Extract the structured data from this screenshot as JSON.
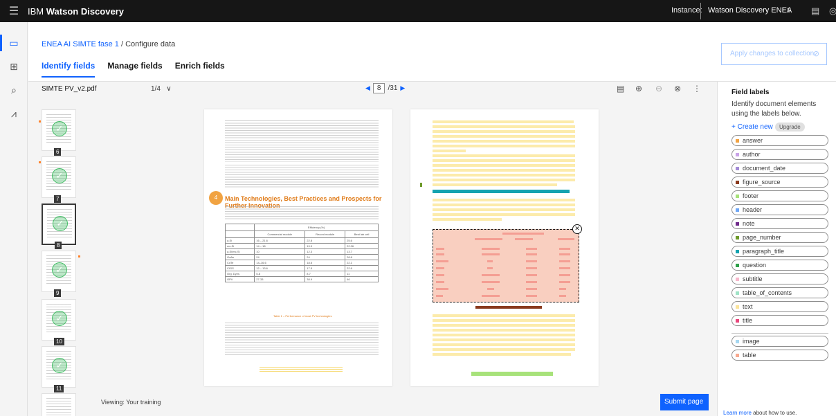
{
  "app": {
    "brand_prefix": "IBM",
    "brand_name": "Watson Discovery",
    "instance_label": "Instance:",
    "instance_value": "Watson Discovery ENEA"
  },
  "breadcrumb": {
    "project": "ENEA AI SIMTE fase 1",
    "separator": "/",
    "current": "Configure data"
  },
  "tabs": [
    "Identify fields",
    "Manage fields",
    "Enrich fields"
  ],
  "apply_button": "Apply changes to collection",
  "toolbar": {
    "filename": "SIMTE PV_v2.pdf",
    "page_range": "1/4",
    "current_page": "8",
    "total_pages": "/31"
  },
  "thumbnails": [
    "6",
    "7",
    "8",
    "9",
    "10",
    "11"
  ],
  "document": {
    "section_heading": "Main Technologies, Best Practices and Prospects for Further Innovation",
    "badge": "4",
    "table_title": "Efficiency (%)",
    "table_headers": [
      "Commercial module",
      "Record module",
      "Best lab cell"
    ],
    "table_rows": [
      [
        "a-Si",
        "16 – 21.6",
        "22.8",
        "25.6"
      ],
      [
        "mc-Si",
        "14 – 18",
        "19.9",
        "22.26"
      ],
      [
        "a-Si/mc-Si",
        "10",
        "12.3",
        "13.7"
      ],
      [
        "GaAs",
        "24",
        "24",
        "28.8"
      ],
      [
        "CdTe",
        "14–16.6",
        "18.6",
        "22.1"
      ],
      [
        "CIGS",
        "12 – 13.6",
        "17.5",
        "22.6"
      ],
      [
        "Org. Dyes",
        "5-8",
        "8.7",
        "11"
      ],
      [
        "OPV",
        "27-33",
        "38.9",
        "46"
      ]
    ],
    "table_caption": "Table 1 – Performance of most PV technologies"
  },
  "viewer": {
    "viewing_text": "Viewing: Your training",
    "submit_label": "Submit page"
  },
  "field_panel": {
    "title": "Field labels",
    "description": "Identify document elements using the labels below.",
    "create_new": "+ Create new",
    "upgrade": "Upgrade",
    "labels": [
      {
        "name": "answer",
        "color": "#f1a342"
      },
      {
        "name": "author",
        "color": "#c9a3e8"
      },
      {
        "name": "document_date",
        "color": "#a38bd6"
      },
      {
        "name": "figure_source",
        "color": "#8a3a1e"
      },
      {
        "name": "footer",
        "color": "#a7e27a"
      },
      {
        "name": "header",
        "color": "#6ea6f5"
      },
      {
        "name": "note",
        "color": "#6f2a8a"
      },
      {
        "name": "page_number",
        "color": "#6d9a2a"
      },
      {
        "name": "paragraph_title",
        "color": "#15a3b0"
      },
      {
        "name": "question",
        "color": "#2ea04a"
      },
      {
        "name": "subtitle",
        "color": "#f7b8cc"
      },
      {
        "name": "table_of_contents",
        "color": "#9fe3c6"
      },
      {
        "name": "text",
        "color": "#fbe49b"
      },
      {
        "name": "title",
        "color": "#e8467c"
      }
    ],
    "extra_labels": [
      {
        "name": "image",
        "color": "#a6d7f0"
      },
      {
        "name": "table",
        "color": "#f7a98f"
      }
    ],
    "learn_more_link": "Learn more",
    "learn_more_text": "about how to use."
  }
}
